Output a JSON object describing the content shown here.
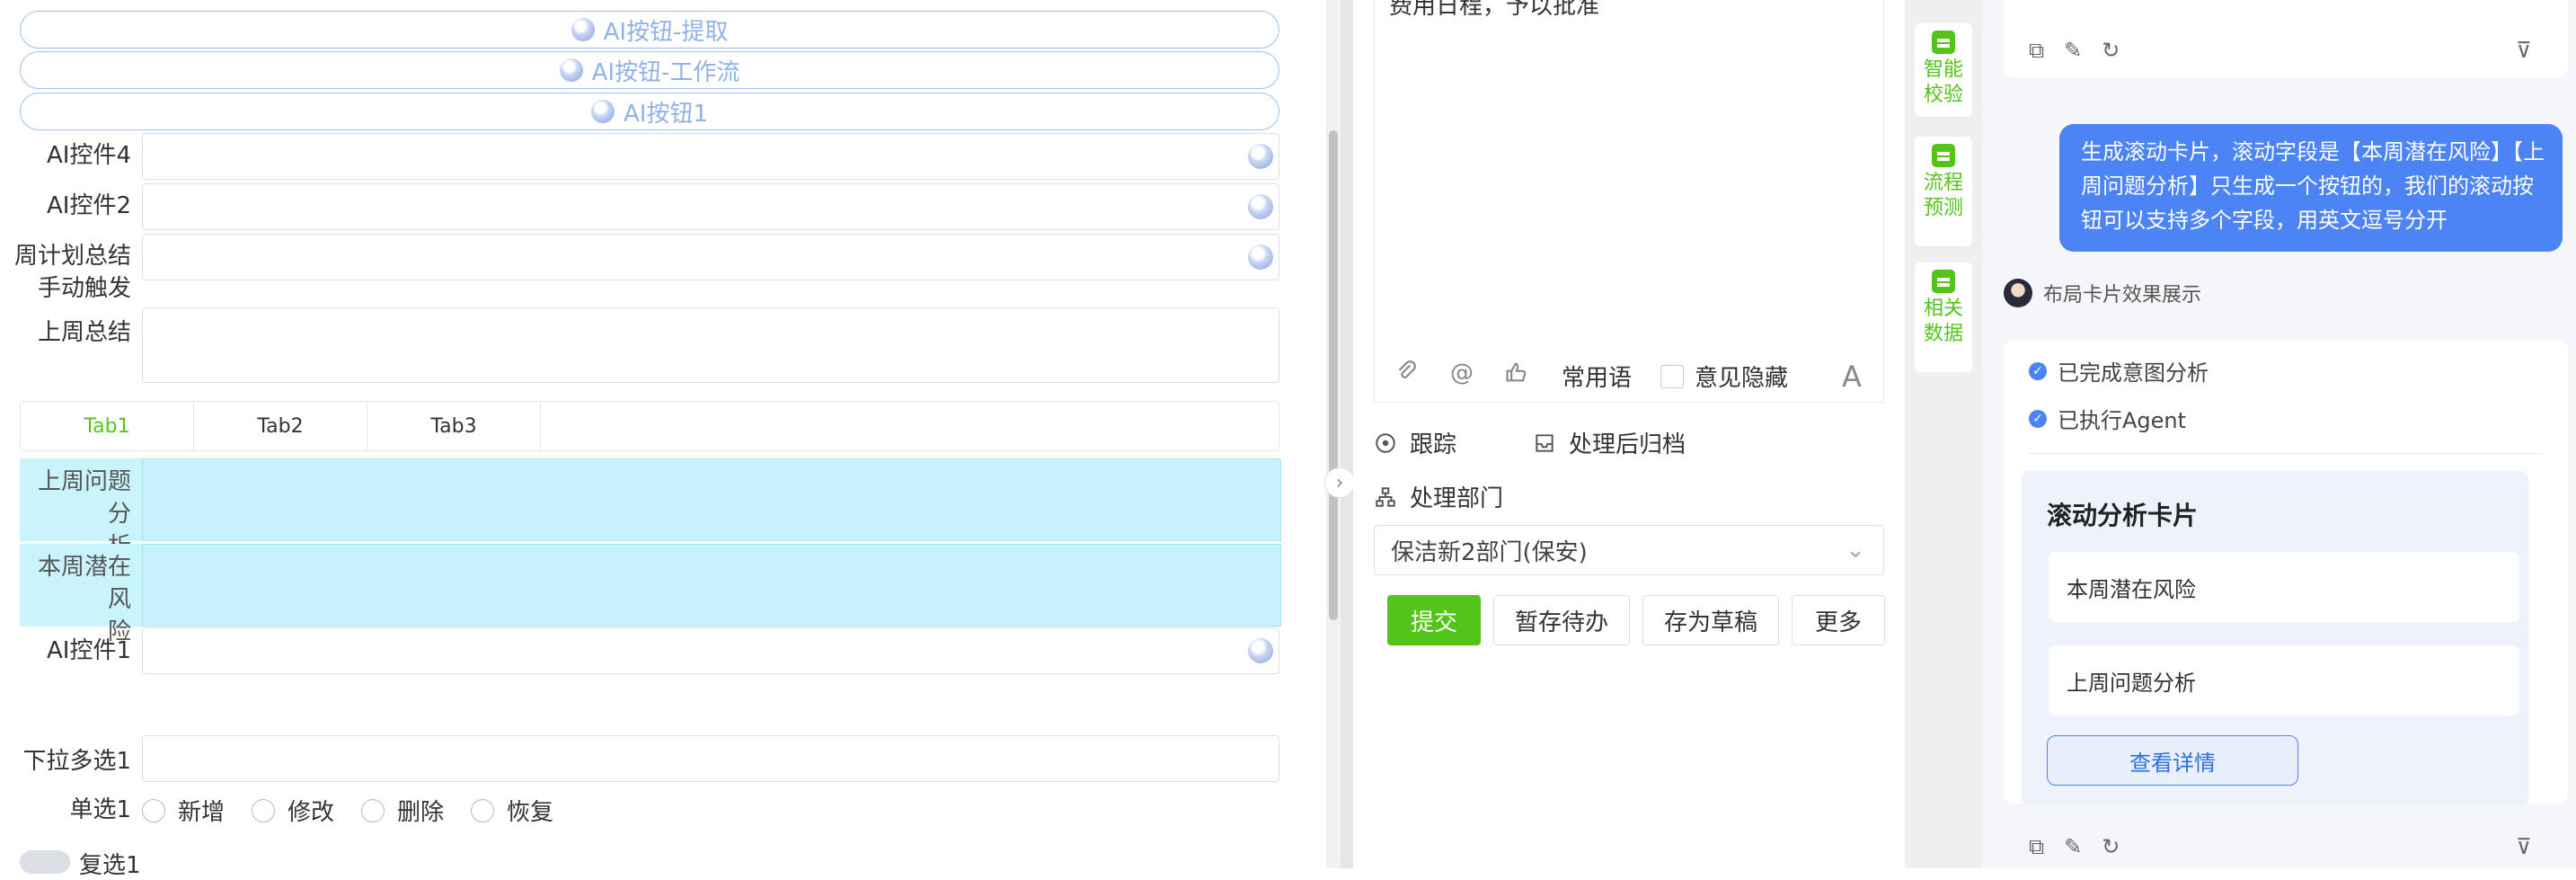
{
  "form": {
    "ai_buttons": [
      "AI按钮-提取",
      "AI按钮-工作流",
      "AI按钮1"
    ],
    "fields": {
      "ai4": "AI控件4",
      "ai2": "AI控件2",
      "weekly_summary_line1": "周计划总结",
      "weekly_summary_line2": "手动触发",
      "last_week_summary": "上周总结",
      "ai1": "AI控件1",
      "dropdown_multi": "下拉多选1",
      "radio_label": "单选1",
      "checkbox_label": "复选1"
    },
    "tabs": [
      "Tab1",
      "Tab2",
      "Tab3"
    ],
    "active_tab": "Tab1",
    "cyan_rows": [
      {
        "line1": "上周问题分",
        "line2": "析"
      },
      {
        "line1": "本周潜在风",
        "line2": "险"
      }
    ],
    "radio_options": [
      "新增",
      "修改",
      "删除",
      "恢复"
    ]
  },
  "middle": {
    "editor_text": "费用日程，予以批准",
    "toolbar": {
      "phrases": "常用语",
      "hide_opinion": "意见隐藏",
      "font_icon": "A"
    },
    "track": "跟踪",
    "archive": "处理后归档",
    "dept_label": "处理部门",
    "dept_value": "保洁新2部门(保安)",
    "buttons": {
      "submit": "提交",
      "save_pending": "暂存待办",
      "save_draft": "存为草稿",
      "more": "更多"
    }
  },
  "strip": [
    {
      "l1": "智能",
      "l2": "校验"
    },
    {
      "l1": "流程",
      "l2": "预测"
    },
    {
      "l1": "相关",
      "l2": "数据"
    }
  ],
  "chat": {
    "user_message": "生成滚动卡片，滚动字段是【本周潜在风险】【上周问题分析】只生成一个按钮的，我们的滚动按钮可以支持多个字段，用英文逗号分开",
    "agent_name": "布局卡片效果展示",
    "checks": [
      "已完成意图分析",
      "已执行Agent"
    ],
    "card_title": "滚动分析卡片",
    "card_fields": [
      "本周潜在风险",
      "上周问题分析"
    ],
    "detail_button": "查看详情"
  },
  "colors": {
    "accent_green": "#52c41a",
    "accent_blue": "#4c83f5",
    "cyan_highlight": "#caf4fb"
  }
}
